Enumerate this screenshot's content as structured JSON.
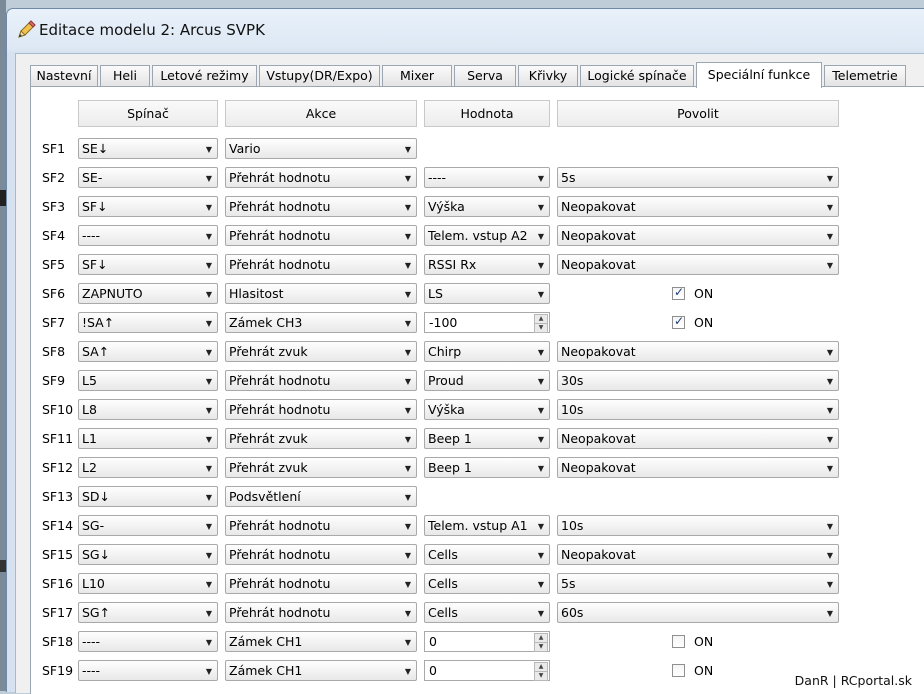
{
  "window": {
    "title": "Editace modelu 2: Arcus SVPK",
    "icon": "pencil-icon"
  },
  "tabs": [
    {
      "label": "Nastevní"
    },
    {
      "label": "Heli"
    },
    {
      "label": "Letové režimy"
    },
    {
      "label": "Vstupy(DR/Expo)"
    },
    {
      "label": "Mixer"
    },
    {
      "label": "Serva"
    },
    {
      "label": "Křivky"
    },
    {
      "label": "Logické spínače"
    },
    {
      "label": "Speciální funkce",
      "active": true
    },
    {
      "label": "Telemetrie"
    }
  ],
  "columns": {
    "switch": "Spínač",
    "action": "Akce",
    "value": "Hodnota",
    "enable": "Povolit"
  },
  "rows": [
    {
      "id": "SF1",
      "switch": "SE↓",
      "action": "Vario"
    },
    {
      "id": "SF2",
      "switch": "SE-",
      "action": "Přehrát hodnotu",
      "value": "----",
      "enable": "5s"
    },
    {
      "id": "SF3",
      "switch": "SF↓",
      "action": "Přehrát hodnotu",
      "value": "Výška",
      "enable": "Neopakovat"
    },
    {
      "id": "SF4",
      "switch": "----",
      "action": "Přehrát hodnotu",
      "value": "Telem. vstup A2",
      "enable": "Neopakovat"
    },
    {
      "id": "SF5",
      "switch": "SF↓",
      "action": "Přehrát hodnotu",
      "value": "RSSI Rx",
      "enable": "Neopakovat"
    },
    {
      "id": "SF6",
      "switch": "ZAPNUTO",
      "action": "Hlasitost",
      "value": "LS",
      "check": true,
      "check_label": "ON"
    },
    {
      "id": "SF7",
      "switch": "!SA↑",
      "action": "Zámek CH3",
      "spin": "-100",
      "check": true,
      "check_label": "ON"
    },
    {
      "id": "SF8",
      "switch": "SA↑",
      "action": "Přehrát zvuk",
      "value": "Chirp",
      "enable": "Neopakovat"
    },
    {
      "id": "SF9",
      "switch": "L5",
      "action": "Přehrát hodnotu",
      "value": "Proud",
      "enable": "30s"
    },
    {
      "id": "SF10",
      "switch": "L8",
      "action": "Přehrát hodnotu",
      "value": "Výška",
      "enable": "10s"
    },
    {
      "id": "SF11",
      "switch": "L1",
      "action": "Přehrát zvuk",
      "value": "Beep 1",
      "enable": "Neopakovat"
    },
    {
      "id": "SF12",
      "switch": "L2",
      "action": "Přehrát zvuk",
      "value": "Beep 1",
      "enable": "Neopakovat"
    },
    {
      "id": "SF13",
      "switch": "SD↓",
      "action": "Podsvětlení"
    },
    {
      "id": "SF14",
      "switch": "SG-",
      "action": "Přehrát hodnotu",
      "value": "Telem. vstup A1",
      "enable": "10s"
    },
    {
      "id": "SF15",
      "switch": "SG↓",
      "action": "Přehrát hodnotu",
      "value": "Cells",
      "enable": "Neopakovat"
    },
    {
      "id": "SF16",
      "switch": "L10",
      "action": "Přehrát hodnotu",
      "value": "Cells",
      "enable": "5s"
    },
    {
      "id": "SF17",
      "switch": "SG↑",
      "action": "Přehrát hodnotu",
      "value": "Cells",
      "enable": "60s"
    },
    {
      "id": "SF18",
      "switch": "----",
      "action": "Zámek CH1",
      "spin": "0",
      "check": false,
      "check_label": "ON"
    },
    {
      "id": "SF19",
      "switch": "----",
      "action": "Zámek CH1",
      "spin": "0",
      "check": false,
      "check_label": "ON"
    }
  ],
  "watermark": "DanR | RCportal.sk"
}
